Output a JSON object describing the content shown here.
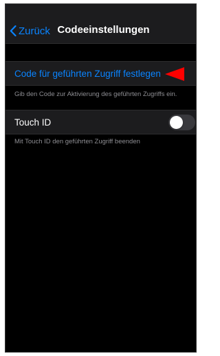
{
  "navbar": {
    "back_label": "Zurück",
    "title": "Codeeinstellungen"
  },
  "code_section": {
    "set_code_label": "Code für geführten Zugriff festlegen",
    "footnote": "Gib den Code zur Aktivierung des geführten Zugriffs ein.",
    "annotation_arrow_color": "#ff0000"
  },
  "touchid_section": {
    "label": "Touch ID",
    "toggle_state": "off",
    "footnote": "Mit Touch ID den geführten Zugriff beenden"
  },
  "colors": {
    "accent": "#0a84ff",
    "background": "#000000",
    "row_background": "#1c1c1e",
    "secondary_text": "#8e8e93"
  }
}
